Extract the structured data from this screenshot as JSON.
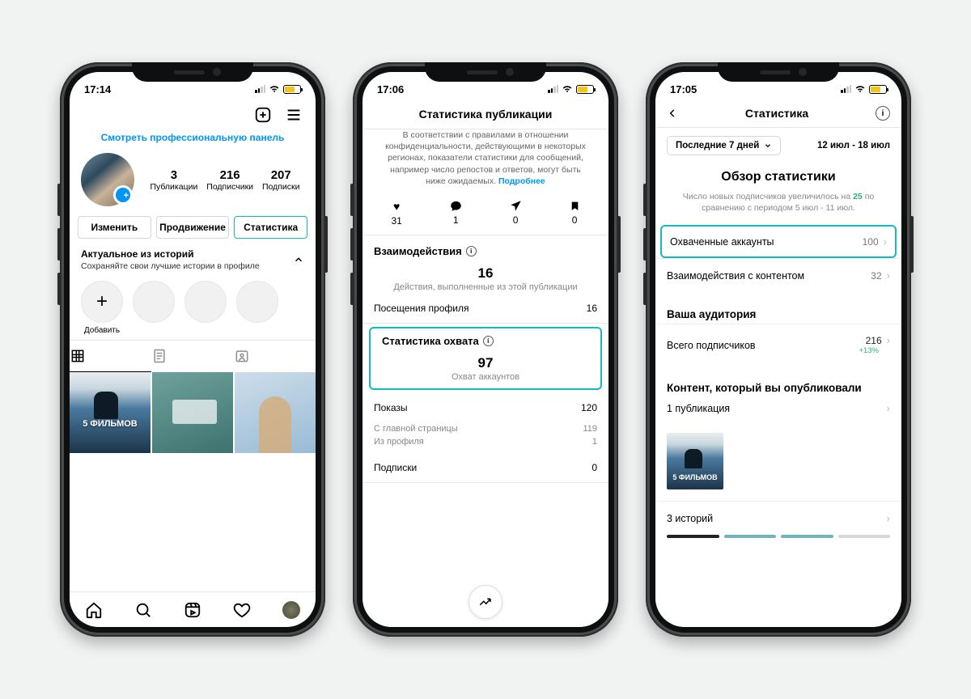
{
  "phone1": {
    "time": "17:14",
    "pro_link": "Смотреть профессиональную панель",
    "stats": {
      "posts": {
        "num": "3",
        "label": "Публикации"
      },
      "followers": {
        "num": "216",
        "label": "Подписчики"
      },
      "following": {
        "num": "207",
        "label": "Подписки"
      }
    },
    "buttons": {
      "edit": "Изменить",
      "promote": "Продвижение",
      "stats": "Статистика"
    },
    "highlights": {
      "title": "Актуальное из историй",
      "sub": "Сохраняйте свои лучшие истории в профиле",
      "add": "Добавить"
    },
    "tile1_text": "5 ФИЛЬМОВ"
  },
  "phone2": {
    "time": "17:06",
    "title": "Статистика публикации",
    "disclaimer_pre": "В соответствии с правилами в отношении конфиденциальности, действующими в некоторых регионах, показатели статистики для сообщений, например число репостов и ответов, могут быть ниже ожидаемых. ",
    "disclaimer_link": "Подробнее",
    "engagement": {
      "likes": "31",
      "comments": "1",
      "shares": "0",
      "saves": "0"
    },
    "interactions": {
      "title": "Взаимодействия",
      "big_num": "16",
      "big_cap": "Действия, выполненные из этой публикации",
      "profile_visits_label": "Посещения профиля",
      "profile_visits_value": "16"
    },
    "reach": {
      "title": "Статистика охвата",
      "big_num": "97",
      "big_cap": "Охват аккаунтов",
      "impressions_label": "Показы",
      "impressions_value": "120",
      "from_home_label": "С главной страницы",
      "from_home_value": "119",
      "from_profile_label": "Из профиля",
      "from_profile_value": "1",
      "follows_label": "Подписки",
      "follows_value": "0"
    }
  },
  "phone3": {
    "time": "17:05",
    "title": "Статистика",
    "range_button": "Последние 7 дней",
    "range_text": "12 июл - 18 июл",
    "overview_title": "Обзор статистики",
    "overview_sub_pre": "Число новых подписчиков увеличилось на ",
    "overview_sub_hl": "25",
    "overview_sub_post": " по сравнению с периодом 5 июл - 11 июл.",
    "rows": {
      "reached": {
        "label": "Охваченные аккаунты",
        "value": "100"
      },
      "interactions": {
        "label": "Взаимодействия с контентом",
        "value": "32"
      }
    },
    "audience": {
      "title": "Ваша аудитория",
      "followers_label": "Всего подписчиков",
      "followers_value": "216",
      "followers_delta": "+13%"
    },
    "content": {
      "title": "Контент, который вы опубликовали",
      "posts_line": "1 публикация",
      "thumb_text": "5 ФИЛЬМОВ",
      "stories_line": "3 историй"
    }
  }
}
